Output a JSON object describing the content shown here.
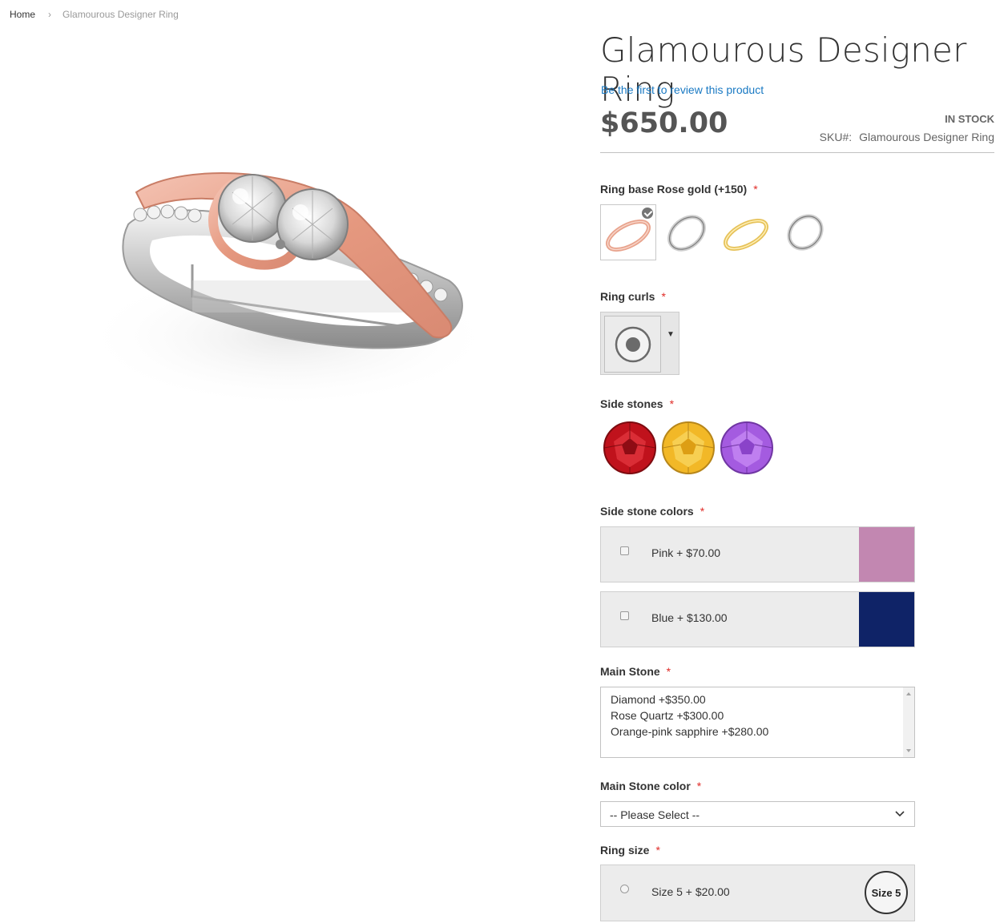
{
  "breadcrumb": {
    "home": "Home",
    "separator": "›",
    "current": "Glamourous Designer Ring"
  },
  "product": {
    "title": "Glamourous Designer Ring",
    "review_link": "Be the first to review this product",
    "price": "$650.00",
    "stock": "IN STOCK",
    "sku_label": "SKU#:",
    "sku_value": "Glamourous Designer Ring"
  },
  "options": {
    "ring_base": {
      "label": "Ring base Rose gold (+150)",
      "required": "*",
      "swatches": [
        {
          "name": "rose-gold-band",
          "color": "#e8a38d",
          "selected": true
        },
        {
          "name": "white-gold-band",
          "color": "#d6d6d6",
          "selected": false
        },
        {
          "name": "yellow-gold-band",
          "color": "#e6c25a",
          "selected": false
        },
        {
          "name": "platinum-band",
          "color": "#cfcfcf",
          "selected": false
        }
      ]
    },
    "ring_curls": {
      "label": "Ring curls",
      "required": "*",
      "icon": "radio-circle-icon"
    },
    "side_stones": {
      "label": "Side stones",
      "required": "*",
      "stones": [
        {
          "name": "ruby-stone",
          "color": "#c0121c"
        },
        {
          "name": "citrine-stone",
          "color": "#f2b827"
        },
        {
          "name": "amethyst-stone",
          "color": "#a45be0"
        }
      ]
    },
    "side_stone_colors": {
      "label": "Side stone colors",
      "required": "*",
      "items": [
        {
          "label": "Pink + $70.00",
          "color": "#c287b1"
        },
        {
          "label": "Blue + $130.00",
          "color": "#0f2367"
        }
      ]
    },
    "main_stone": {
      "label": "Main Stone",
      "required": "*",
      "items": [
        "Diamond +$350.00",
        "Rose Quartz +$300.00",
        "Orange-pink sapphire +$280.00"
      ]
    },
    "main_stone_color": {
      "label": "Main Stone color",
      "required": "*",
      "selected": "-- Please Select --"
    },
    "ring_size": {
      "label": "Ring size",
      "required": "*",
      "item_label": "Size 5 + $20.00",
      "badge": "Size 5"
    }
  },
  "colors": {
    "link": "#1979c3",
    "required": "#e02b27",
    "rose_gold": "#e8a38d"
  }
}
